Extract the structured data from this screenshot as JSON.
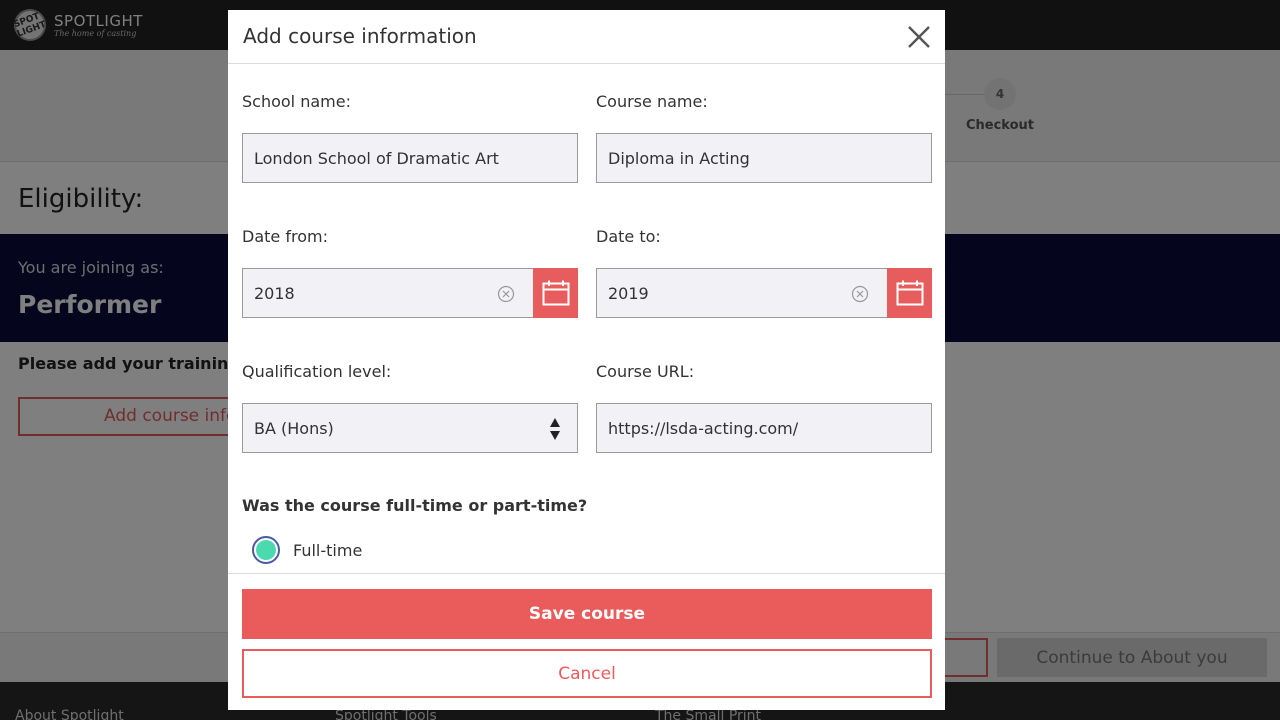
{
  "brand": {
    "name": "SPOTLIGHT",
    "tagline": "The home of casting",
    "mark": "SPOT LIGHT"
  },
  "stepper": {
    "current_step_number": "4",
    "current_step_label": "Checkout"
  },
  "background_page": {
    "title": "Eligibility:",
    "joining_label": "You are joining as:",
    "joining_value": "Performer",
    "training_prompt": "Please add your training inf",
    "add_course_button": "Add course info",
    "continue_button": "Continue to About you"
  },
  "footer_links": [
    "About Spotlight",
    "Spotlight Tools",
    "The Small Print"
  ],
  "modal": {
    "title": "Add course information",
    "school_name": {
      "label": "School name:",
      "value": "London School of Dramatic Art"
    },
    "course_name": {
      "label": "Course name:",
      "value": "Diploma in Acting"
    },
    "date_from": {
      "label": "Date from:",
      "value": "2018"
    },
    "date_to": {
      "label": "Date to:",
      "value": "2019"
    },
    "qualification_level": {
      "label": "Qualification level:",
      "value": "BA (Hons)"
    },
    "course_url": {
      "label": "Course URL:",
      "value": "https://lsda-acting.com/"
    },
    "attendance": {
      "question": "Was the course full-time or part-time?",
      "options": [
        {
          "label": "Full-time",
          "selected": true
        }
      ]
    },
    "save_button": "Save course",
    "cancel_button": "Cancel"
  },
  "colors": {
    "accent": "#ea5c5b",
    "banner": "#0a0a3c",
    "radio_selected": "#4dd9b0",
    "radio_ring": "#4a5aa8"
  }
}
